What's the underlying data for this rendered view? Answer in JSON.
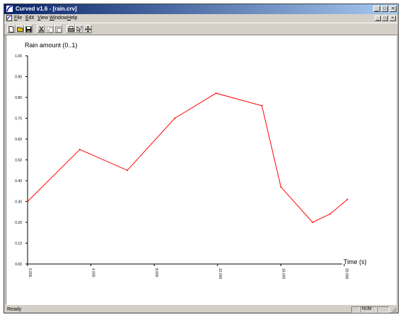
{
  "window": {
    "title": "Curved v1.6 - [rain.crv]",
    "min_glyph": "_",
    "max_glyph": "□",
    "close_glyph": "×"
  },
  "menu": {
    "items": [
      {
        "label": "File",
        "key": "F"
      },
      {
        "label": "Edit",
        "key": "E"
      },
      {
        "label": "View",
        "key": "V"
      },
      {
        "label": "Window",
        "key": "W"
      },
      {
        "label": "Help",
        "key": "H"
      }
    ]
  },
  "toolbar": {
    "buttons": [
      "new-file-icon",
      "open-folder-icon",
      "save-disk-icon",
      "cut-scissors-icon",
      "copy-icon",
      "paste-icon",
      "print-icon",
      "help-pointer-icon",
      "move-crosshair-icon"
    ]
  },
  "chart_data": {
    "type": "line",
    "ylabel": "Rain amount (0..1)",
    "xlabel": "Time (s)",
    "xlim": [
      0,
      20
    ],
    "ylim": [
      0,
      1
    ],
    "y_ticks": [
      "0.00",
      "0.10",
      "0.20",
      "0.30",
      "0.40",
      "0.50",
      "0.60",
      "0.70",
      "0.80",
      "0.90",
      "1.00"
    ],
    "x_ticks": [
      "0.000",
      "4.000",
      "8.000",
      "12.000",
      "16.000",
      "20.000"
    ],
    "x_tick_values": [
      0,
      4,
      8,
      12,
      16,
      20
    ],
    "series": [
      {
        "color": "#ff0000",
        "x": [
          0,
          3.3,
          6.3,
          9.3,
          11.9,
          14.8,
          16.0,
          18.0,
          19.1,
          20.2
        ],
        "y": [
          0.3,
          0.55,
          0.45,
          0.7,
          0.82,
          0.76,
          0.37,
          0.2,
          0.24,
          0.31
        ]
      }
    ],
    "grid": false
  },
  "status": {
    "text": "Ready",
    "num": "NUM"
  }
}
